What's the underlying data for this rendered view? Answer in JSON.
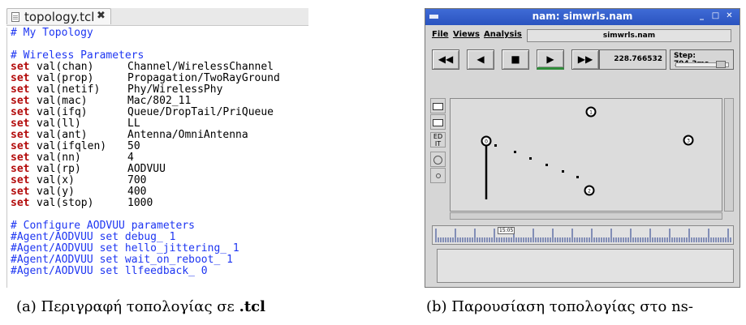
{
  "editor": {
    "tab_label": "topology.tcl",
    "tab_close": "✖",
    "lines": [
      {
        "kind": "comment",
        "text": "# My Topology"
      },
      {
        "kind": "blank"
      },
      {
        "kind": "comment",
        "text": "# Wireless Parameters"
      },
      {
        "kind": "set",
        "kw": "set",
        "var": "val(chan)",
        "value": "Channel/WirelessChannel"
      },
      {
        "kind": "set",
        "kw": "set",
        "var": "val(prop)",
        "value": "Propagation/TwoRayGround"
      },
      {
        "kind": "set",
        "kw": "set",
        "var": "val(netif)",
        "value": "Phy/WirelessPhy"
      },
      {
        "kind": "set",
        "kw": "set",
        "var": "val(mac)",
        "value": "Mac/802_11"
      },
      {
        "kind": "set",
        "kw": "set",
        "var": "val(ifq)",
        "value": "Queue/DropTail/PriQueue"
      },
      {
        "kind": "set",
        "kw": "set",
        "var": "val(ll)",
        "value": "LL"
      },
      {
        "kind": "set",
        "kw": "set",
        "var": "val(ant)",
        "value": "Antenna/OmniAntenna"
      },
      {
        "kind": "set",
        "kw": "set",
        "var": "val(ifqlen)",
        "value": "50"
      },
      {
        "kind": "set",
        "kw": "set",
        "var": "val(nn)",
        "value": "4"
      },
      {
        "kind": "set",
        "kw": "set",
        "var": "val(rp)",
        "value": "AODVUU"
      },
      {
        "kind": "set",
        "kw": "set",
        "var": "val(x)",
        "value": "700"
      },
      {
        "kind": "set",
        "kw": "set",
        "var": "val(y)",
        "value": "400"
      },
      {
        "kind": "set",
        "kw": "set",
        "var": "val(stop)",
        "value": "1000"
      },
      {
        "kind": "blank"
      },
      {
        "kind": "comment",
        "text": "# Configure AODVUU parameters"
      },
      {
        "kind": "comment",
        "text": "#Agent/AODVUU set debug_ 1"
      },
      {
        "kind": "comment",
        "text": "#Agent/AODVUU set hello_jittering_ 1"
      },
      {
        "kind": "comment",
        "text": "#Agent/AODVUU set wait_on_reboot_ 1"
      },
      {
        "kind": "comment",
        "text": "#Agent/AODVUU set llfeedback_ 0"
      }
    ]
  },
  "nam": {
    "window_title": "nam: simwrls.nam",
    "window_buttons": [
      "_",
      "□",
      "✕"
    ],
    "menu": [
      "File",
      "Views",
      "Analysis"
    ],
    "file_field": "simwrls.nam",
    "controls": [
      {
        "name": "rewind-button",
        "icon": "rewind-icon",
        "glyph": "◀◀"
      },
      {
        "name": "back-button",
        "icon": "back-icon",
        "glyph": "◀"
      },
      {
        "name": "stop-button",
        "icon": "stop-icon",
        "glyph": "■"
      },
      {
        "name": "play-button",
        "icon": "play-icon",
        "glyph": "▶"
      },
      {
        "name": "fast-forward-button",
        "icon": "fast-forward-icon",
        "glyph": "▶▶"
      }
    ],
    "time": "228.766532",
    "step": "Step: 794.3ms",
    "tools": [
      {
        "name": "zoom-in-tool",
        "icon": "zoom-in-icon",
        "glyph": ""
      },
      {
        "name": "zoom-out-tool",
        "icon": "zoom-out-icon",
        "glyph": ""
      },
      {
        "name": "edit-tool",
        "icon": "edit-icon",
        "glyph": "ED\nIT"
      },
      {
        "name": "node-tool",
        "icon": "circle-icon",
        "glyph": ""
      },
      {
        "name": "link-tool",
        "icon": "link-icon",
        "glyph": ""
      }
    ],
    "nodes": [
      {
        "id": "0",
        "label": "0"
      },
      {
        "id": "1",
        "label": "1"
      },
      {
        "id": "2",
        "label": "2"
      },
      {
        "id": "3",
        "label": "3"
      }
    ],
    "timeline_label": "15:05"
  },
  "captions": {
    "a_prefix": "(a) Περιγραφή τοπολογίας σε ",
    "a_bold": ".tcl",
    "b_text": "(b) Παρουσίαση τοπολογίας στο ns-"
  },
  "colors": {
    "comment": "#1e36f2",
    "keyword": "#b30b0b",
    "titlebar": "#3f6bd6",
    "play_indicator": "#2f8c3a"
  }
}
